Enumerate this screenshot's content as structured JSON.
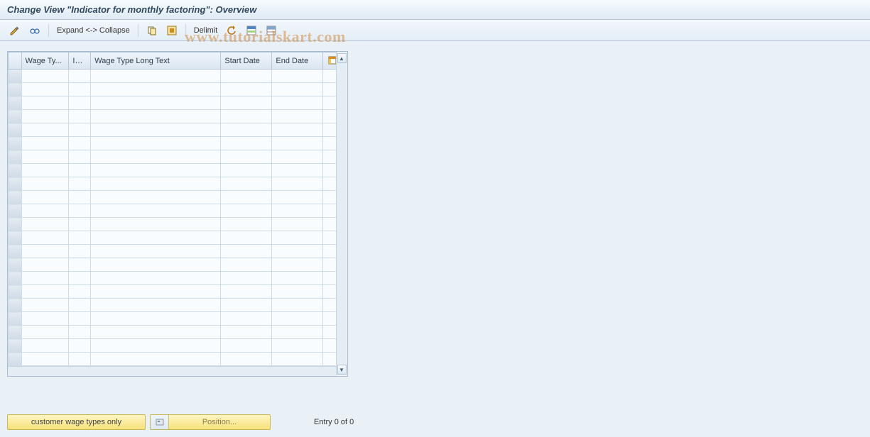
{
  "title": "Change View \"Indicator for monthly factoring\": Overview",
  "toolbar": {
    "expand_label": "Expand <-> Collapse",
    "delimit_label": "Delimit"
  },
  "table": {
    "columns": {
      "wage_type": "Wage Ty...",
      "inf": "Inf...",
      "long_text": "Wage Type Long Text",
      "start_date": "Start Date",
      "end_date": "End Date"
    },
    "row_count": 22
  },
  "footer": {
    "customer_btn": "customer wage types only",
    "position_btn": "Position...",
    "entry_text": "Entry 0 of 0"
  },
  "watermark": "www.tutorialskart.com"
}
